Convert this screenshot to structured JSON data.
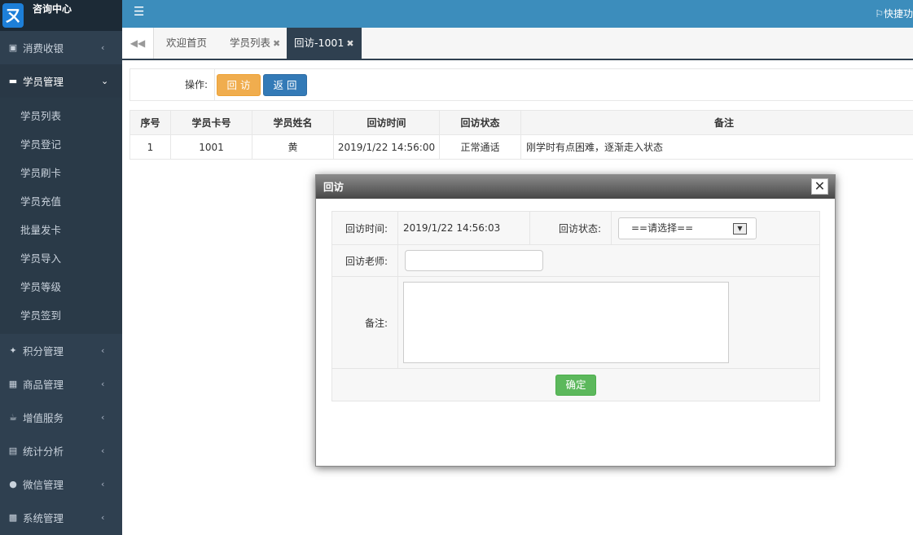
{
  "brand": {
    "title": "咨询中心",
    "logo_glyph": "ㄡ"
  },
  "topbar": {
    "quick_label": "快捷功"
  },
  "sidebar": {
    "items": [
      {
        "label": "消费收银",
        "icon": "bag-icon"
      },
      {
        "label": "学员管理",
        "icon": "idcard-icon",
        "active": true,
        "sub": [
          "学员列表",
          "学员登记",
          "学员刷卡",
          "学员充值",
          "批量发卡",
          "学员导入",
          "学员等级",
          "学员签到"
        ]
      },
      {
        "label": "积分管理",
        "icon": "star-icon"
      },
      {
        "label": "商品管理",
        "icon": "barcode-icon"
      },
      {
        "label": "增值服务",
        "icon": "coffee-icon"
      },
      {
        "label": "统计分析",
        "icon": "chart-icon"
      },
      {
        "label": "微信管理",
        "icon": "wechat-icon"
      },
      {
        "label": "系统管理",
        "icon": "monitor-icon"
      }
    ]
  },
  "tabs": [
    {
      "label": "欢迎首页"
    },
    {
      "label": "学员列表"
    },
    {
      "label": "回访-1001"
    }
  ],
  "toolbar": {
    "label": "操作:",
    "revisit_button": "回 访",
    "back_button": "返 回"
  },
  "table": {
    "headers": [
      "序号",
      "学员卡号",
      "学员姓名",
      "回访时间",
      "回访状态",
      "备注"
    ],
    "rows": [
      [
        "1",
        "1001",
        "黄",
        "2019/1/22 14:56:00",
        "正常通话",
        "刚学时有点困难，逐渐走入状态"
      ]
    ]
  },
  "dialog": {
    "title": "回访",
    "time_label": "回访时间:",
    "time_value": "2019/1/22 14:56:03",
    "status_label": "回访状态:",
    "status_value": "==请选择==",
    "teacher_label": "回访老师:",
    "teacher_value": "",
    "note_label": "备注:",
    "note_value": "",
    "confirm_button": "确定"
  },
  "colors": {
    "sidebar": "#2f4050",
    "topbar": "#3c8dbc",
    "warning": "#f0ad4e",
    "primary": "#337ab7",
    "success": "#5cb85c"
  }
}
